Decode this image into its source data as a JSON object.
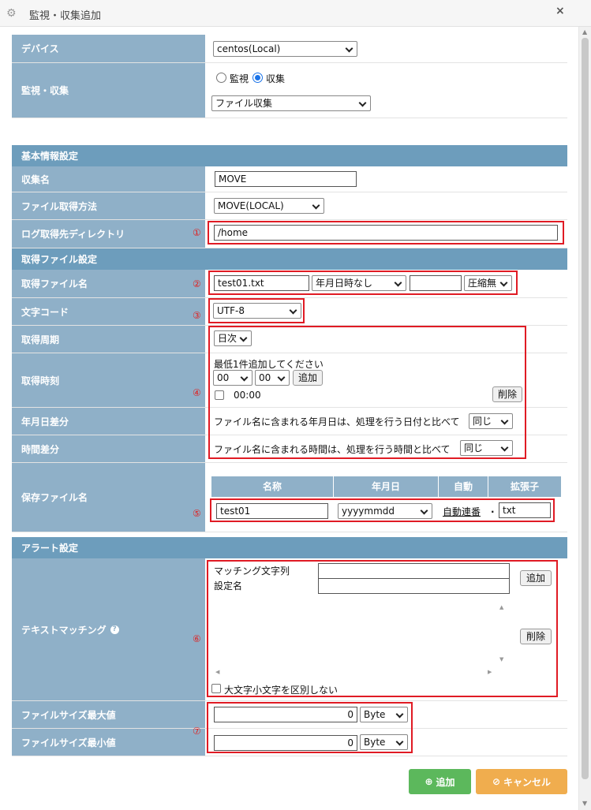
{
  "window": {
    "title": "監視・収集追加",
    "close": "×"
  },
  "device": {
    "label": "デバイス",
    "value": "centos(Local)"
  },
  "mode": {
    "label": "監視・収集",
    "option_monitor": "監視",
    "option_collect": "収集",
    "type_value": "ファイル収集"
  },
  "basic": {
    "section": "基本情報設定",
    "name_label": "収集名",
    "name_value": "MOVE",
    "method_label": "ファイル取得方法",
    "method_value": "MOVE(LOCAL)",
    "dir_label": "ログ取得先ディレクトリ",
    "dir_value": "/home"
  },
  "file": {
    "section": "取得ファイル設定",
    "name_label": "取得ファイル名",
    "name_value": "test01.txt",
    "date_format": "年月日時なし",
    "extra_value": "",
    "compress": "圧縮無",
    "charset_label": "文字コード",
    "charset_value": "UTF-8",
    "period_label": "取得周期",
    "period_value": "日次",
    "time_label": "取得時刻",
    "time_hint": "最低1件追加してください",
    "hour": "00",
    "minute": "00",
    "add": "追加",
    "entry_time": "00:00",
    "delete": "削除",
    "datediff_label": "年月日差分",
    "datediff_text": "ファイル名に含まれる年月日は、処理を行う日付と比べて",
    "datediff_value": "同じ",
    "timediff_label": "時間差分",
    "timediff_text": "ファイル名に含まれる時間は、処理を行う時間と比べて",
    "timediff_value": "同じ",
    "save_label": "保存ファイル名",
    "save_headers": [
      "名称",
      "年月日",
      "自動",
      "拡張子"
    ],
    "save_name": "test01",
    "save_date": "yyyymmdd",
    "save_auto": "自動連番",
    "save_dot": ".",
    "save_ext": "txt"
  },
  "alert": {
    "section": "アラート設定",
    "match_label": "テキストマッチング",
    "help": "?",
    "match_string_label": "マッチング文字列",
    "match_string_value": "",
    "setting_name_label": "設定名",
    "setting_name_value": "",
    "add": "追加",
    "delete": "削除",
    "case_label": "大文字小文字を区別しない",
    "max_label": "ファイルサイズ最大値",
    "max_value": "0",
    "max_unit": "Byte",
    "min_label": "ファイルサイズ最小値",
    "min_value": "0",
    "min_unit": "Byte"
  },
  "markers": [
    "①",
    "②",
    "③",
    "④",
    "⑤",
    "⑥",
    "⑦"
  ],
  "footer": {
    "add": "追加",
    "cancel": "キャンセル"
  }
}
